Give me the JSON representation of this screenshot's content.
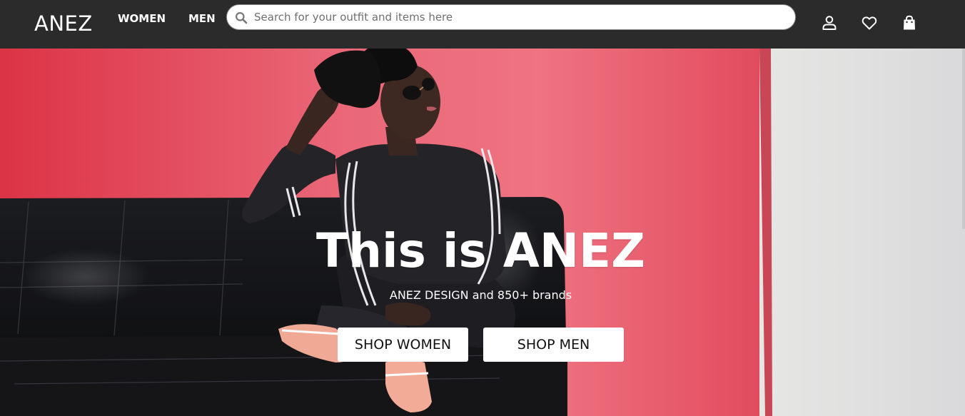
{
  "brand": {
    "logo_text": "ANEZ"
  },
  "nav": {
    "links": [
      {
        "label": "WOMEN"
      },
      {
        "label": "MEN"
      }
    ]
  },
  "search": {
    "placeholder": "Search for your outfit and items here",
    "value": "",
    "icon": "magnifier"
  },
  "header_icons": [
    {
      "name": "account-icon",
      "glyph": "person outline"
    },
    {
      "name": "wishlist-icon",
      "glyph": "heart outline"
    },
    {
      "name": "shopping-bag-icon",
      "glyph": "bag"
    }
  ],
  "hero": {
    "title": "This is ANEZ",
    "subtitle": "ANEZ DESIGN and 850+ brands",
    "buttons": [
      {
        "label": "SHOP WOMEN"
      },
      {
        "label": "SHOP MEN"
      }
    ],
    "image_description_colors": {
      "wall": "#e44a5c",
      "side_wall": "#e4e4e2",
      "sofa": "#141416"
    }
  },
  "colors": {
    "navbar_bg": "#2b2b2b",
    "text_on_dark": "#ffffff",
    "button_bg": "#ffffff",
    "button_text": "#111111"
  }
}
